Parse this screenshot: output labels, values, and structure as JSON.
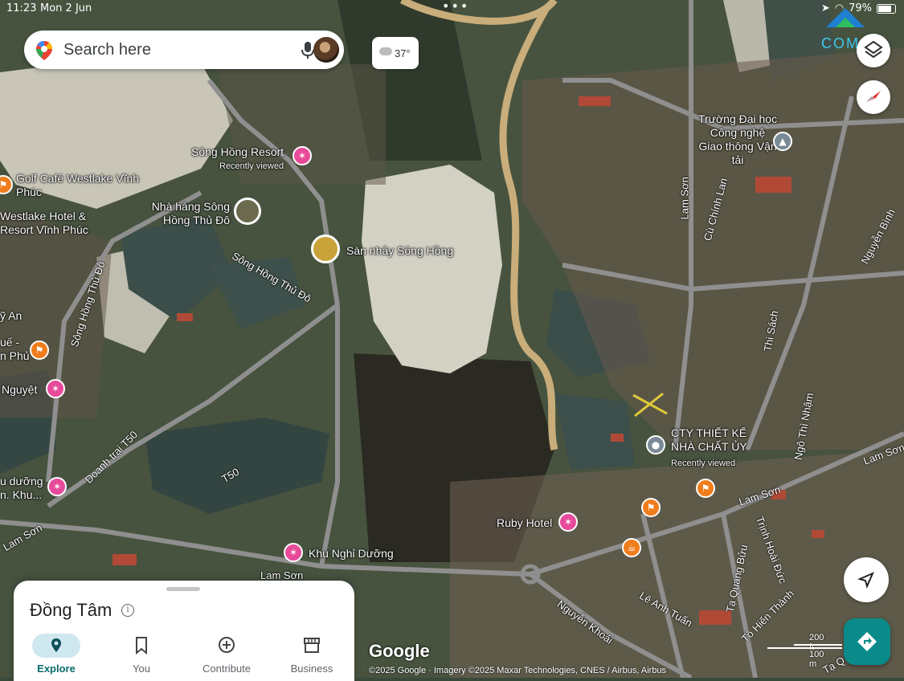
{
  "status_bar": {
    "time": "11:23",
    "date": "Mon 2 Jun",
    "battery": "79%"
  },
  "search": {
    "placeholder": "Search here"
  },
  "weather": {
    "temperature": "37°"
  },
  "watermark": {
    "text": "COM"
  },
  "places": [
    {
      "name": "Sông Hồng Resort",
      "subtitle": "Recently viewed"
    },
    {
      "name": "Golf Café Westlake Vĩnh Phúc"
    },
    {
      "name": "Westlake Hotel & Resort Vĩnh Phúc"
    },
    {
      "name": "Nhà hàng Sông Hồng Thủ Đô"
    },
    {
      "name": "Sàn nhảy Sông Hồng"
    },
    {
      "name": "Trường Đại học Công nghệ Giao thông Vận tải"
    },
    {
      "name": "CTY THIẾT KẾ NHÀ CHẤT ỦY",
      "subtitle": "Recently viewed"
    },
    {
      "name": "Ruby Hotel"
    },
    {
      "name": "Khu Nghỉ Dưỡng"
    },
    {
      "name": "Nguyệt"
    },
    {
      "name": "ỹ An"
    },
    {
      "name": "uế -\nn Phủ"
    },
    {
      "name": "u dưỡng\nn. Khu..."
    }
  ],
  "roads": [
    "Lam Sơn",
    "Lam Sơn",
    "Lam Sơn",
    "Lam Sơn",
    "Lam Sơn",
    "Sông Hồng Thủ Đô",
    "Sông Hồng Thủ Đô",
    "Doanh trại T50",
    "T50",
    "Cù Chính Lan",
    "Thi Sách",
    "Ngô Thì Nhậm",
    "Nguyễn Bình",
    "Tạ Quang Bửu",
    "Trịnh Hoài Đức",
    "Tô Hiến Thành",
    "Lê Anh Tuấn",
    "Nguyễn Khoái",
    "Tạ Q"
  ],
  "bottom_sheet": {
    "place_name": "Đồng Tâm",
    "tabs": [
      {
        "label": "Explore",
        "icon": "location-pin-icon",
        "active": true
      },
      {
        "label": "You",
        "icon": "bookmark-icon",
        "active": false
      },
      {
        "label": "Contribute",
        "icon": "add-circle-icon",
        "active": false
      },
      {
        "label": "Business",
        "icon": "storefront-icon",
        "active": false
      }
    ]
  },
  "map_footer": {
    "logo": "Google",
    "attribution": "©2025 Google · Imagery ©2025 Maxar Technologies, CNES / Airbus, Airbus",
    "scale_ft": "200 ft",
    "scale_m": "100 m"
  },
  "colors": {
    "directions_button": "#0b8a8a",
    "poi_hotel": "#e84a9a",
    "poi_food": "#f07d1c",
    "active_tab": "#0b6b6b"
  }
}
